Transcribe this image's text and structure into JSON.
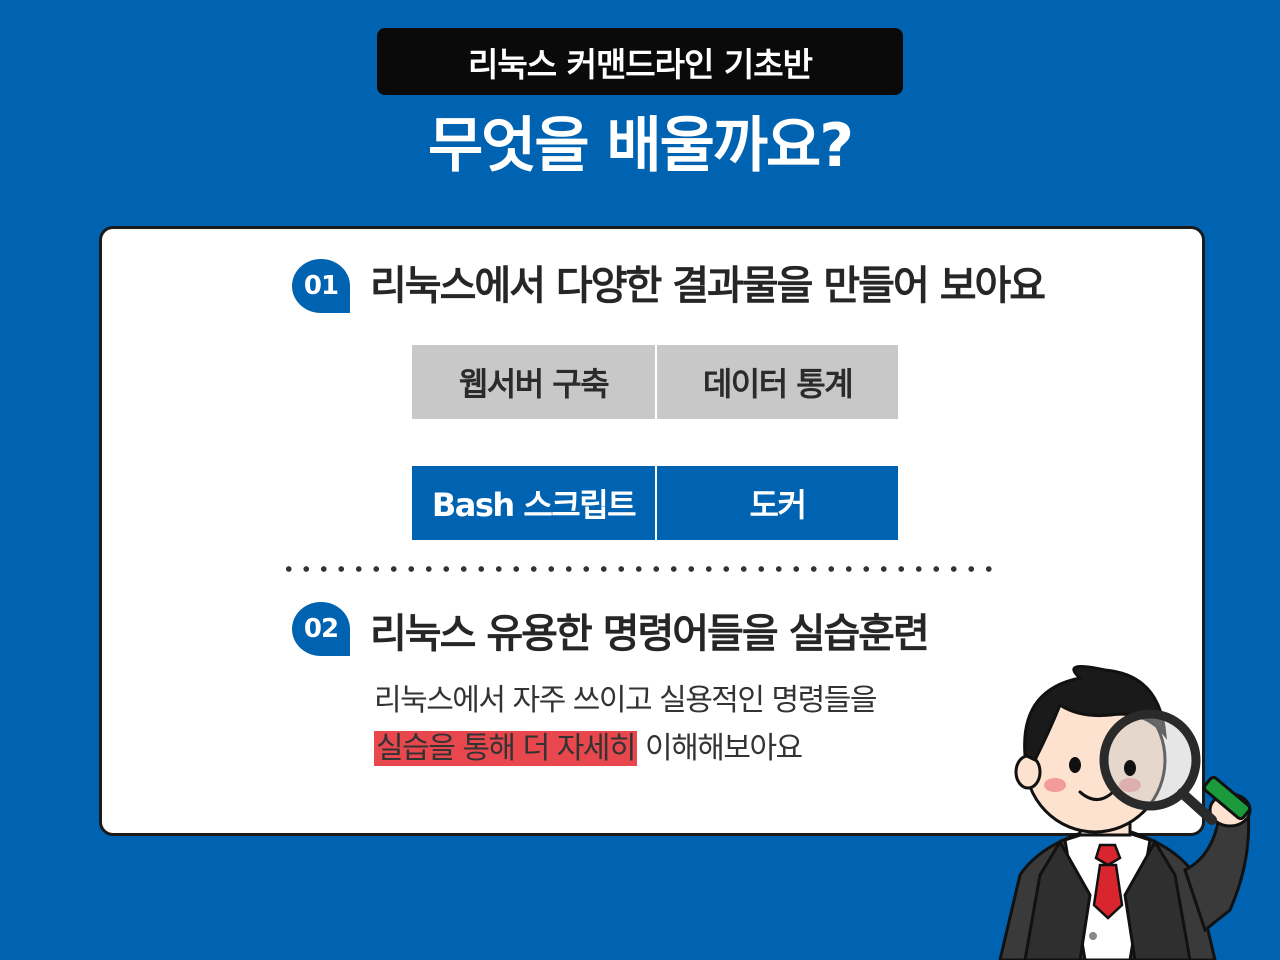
{
  "header": {
    "course_tag": "리눅스 커맨드라인 기초반",
    "headline": "무엇을 배울까요?"
  },
  "section1": {
    "number": "01",
    "title": "리눅스에서 다양한 결과물을 만들어 보아요",
    "results": [
      {
        "label": "웹서버 구축"
      },
      {
        "label": "데이터 통계"
      },
      {
        "label": "Bash 스크립트"
      },
      {
        "label": "도커"
      }
    ]
  },
  "section2": {
    "number": "02",
    "title": "리눅스 유용한 명령어들을 실습훈련",
    "desc_line1": "리눅스에서 자주 쓰이고 실용적인 명령들을",
    "desc_line2_highlight": "실습을 통해 더 자세히",
    "desc_line2_rest": " 이해해보아요"
  },
  "colors": {
    "background": "#0063b1",
    "accent_blue": "#0063b1",
    "tile_gray": "#c8c8c8",
    "highlight_red": "#e8474d"
  },
  "icons": {
    "character": "businessman-with-magnifying-glass-icon"
  }
}
